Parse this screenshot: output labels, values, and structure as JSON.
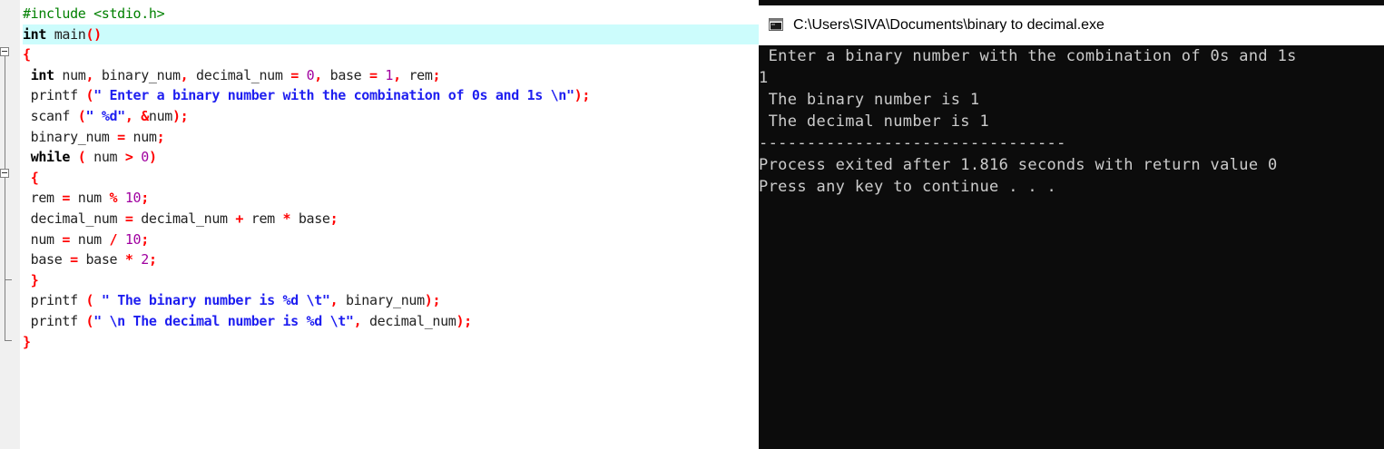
{
  "editor": {
    "lines": [
      [
        [
          "pp",
          "#include <stdio.h>"
        ]
      ],
      [
        [
          "kw",
          "int"
        ],
        [
          "id",
          " main"
        ],
        [
          "sym",
          "()"
        ]
      ],
      [
        [
          "sym",
          "{"
        ]
      ],
      [
        [
          "id",
          " "
        ],
        [
          "kw",
          "int"
        ],
        [
          "id",
          " num"
        ],
        [
          "sym",
          ","
        ],
        [
          "id",
          " binary_num"
        ],
        [
          "sym",
          ","
        ],
        [
          "id",
          " decimal_num "
        ],
        [
          "sym",
          "="
        ],
        [
          "id",
          " "
        ],
        [
          "num",
          "0"
        ],
        [
          "sym",
          ","
        ],
        [
          "id",
          " base "
        ],
        [
          "sym",
          "="
        ],
        [
          "id",
          " "
        ],
        [
          "num",
          "1"
        ],
        [
          "sym",
          ","
        ],
        [
          "id",
          " rem"
        ],
        [
          "sym",
          ";"
        ]
      ],
      [
        [
          "id",
          " printf "
        ],
        [
          "sym",
          "("
        ],
        [
          "str",
          "\" Enter a binary number with the combination of 0s and 1s \\n\""
        ],
        [
          "sym",
          ");"
        ]
      ],
      [
        [
          "id",
          " scanf "
        ],
        [
          "sym",
          "("
        ],
        [
          "str",
          "\" %d\""
        ],
        [
          "sym",
          ","
        ],
        [
          "id",
          " "
        ],
        [
          "sym",
          "&"
        ],
        [
          "id",
          "num"
        ],
        [
          "sym",
          ");"
        ]
      ],
      [
        [
          "id",
          " binary_num "
        ],
        [
          "sym",
          "="
        ],
        [
          "id",
          " num"
        ],
        [
          "sym",
          ";"
        ]
      ],
      [
        [
          "id",
          " "
        ],
        [
          "kw",
          "while"
        ],
        [
          "id",
          " "
        ],
        [
          "sym",
          "("
        ],
        [
          "id",
          " num "
        ],
        [
          "sym",
          ">"
        ],
        [
          "id",
          " "
        ],
        [
          "num",
          "0"
        ],
        [
          "sym",
          ")"
        ]
      ],
      [
        [
          "id",
          " "
        ],
        [
          "sym",
          "{"
        ]
      ],
      [
        [
          "id",
          " rem "
        ],
        [
          "sym",
          "="
        ],
        [
          "id",
          " num "
        ],
        [
          "sym",
          "%"
        ],
        [
          "id",
          " "
        ],
        [
          "num",
          "10"
        ],
        [
          "sym",
          ";"
        ]
      ],
      [
        [
          "id",
          " decimal_num "
        ],
        [
          "sym",
          "="
        ],
        [
          "id",
          " decimal_num "
        ],
        [
          "sym",
          "+"
        ],
        [
          "id",
          " rem "
        ],
        [
          "sym",
          "*"
        ],
        [
          "id",
          " base"
        ],
        [
          "sym",
          ";"
        ]
      ],
      [
        [
          "id",
          " num "
        ],
        [
          "sym",
          "="
        ],
        [
          "id",
          " num "
        ],
        [
          "sym",
          "/"
        ],
        [
          "id",
          " "
        ],
        [
          "num",
          "10"
        ],
        [
          "sym",
          ";"
        ]
      ],
      [
        [
          "id",
          " base "
        ],
        [
          "sym",
          "="
        ],
        [
          "id",
          " base "
        ],
        [
          "sym",
          "*"
        ],
        [
          "id",
          " "
        ],
        [
          "num",
          "2"
        ],
        [
          "sym",
          ";"
        ]
      ],
      [
        [
          "id",
          " "
        ],
        [
          "sym",
          "}"
        ]
      ],
      [
        [
          "id",
          " printf "
        ],
        [
          "sym",
          "("
        ],
        [
          "id",
          " "
        ],
        [
          "str",
          "\" The binary number is %d \\t\""
        ],
        [
          "sym",
          ","
        ],
        [
          "id",
          " binary_num"
        ],
        [
          "sym",
          ");"
        ]
      ],
      [
        [
          "id",
          " printf "
        ],
        [
          "sym",
          "("
        ],
        [
          "str",
          "\" \\n The decimal number is %d \\t\""
        ],
        [
          "sym",
          ","
        ],
        [
          "id",
          " decimal_num"
        ],
        [
          "sym",
          ");"
        ]
      ],
      [
        [
          "sym",
          "}"
        ]
      ]
    ],
    "current_line_index": 1
  },
  "console": {
    "title": "C:\\Users\\SIVA\\Documents\\binary to decimal.exe",
    "icon": "console-window-icon",
    "lines": [
      " Enter a binary number with the combination of 0s and 1s",
      "1",
      " The binary number is 1",
      " The decimal number is 1",
      "--------------------------------",
      "Process exited after 1.816 seconds with return value 0",
      "Press any key to continue . . ."
    ]
  },
  "colors": {
    "current_line_bg": "#ccfcfc",
    "console_bg": "#0c0c0c",
    "console_text": "#cccccc",
    "preprocessor": "#008000",
    "string": "#1e1ef0",
    "number": "#a000a0",
    "symbol": "#ff0000"
  }
}
